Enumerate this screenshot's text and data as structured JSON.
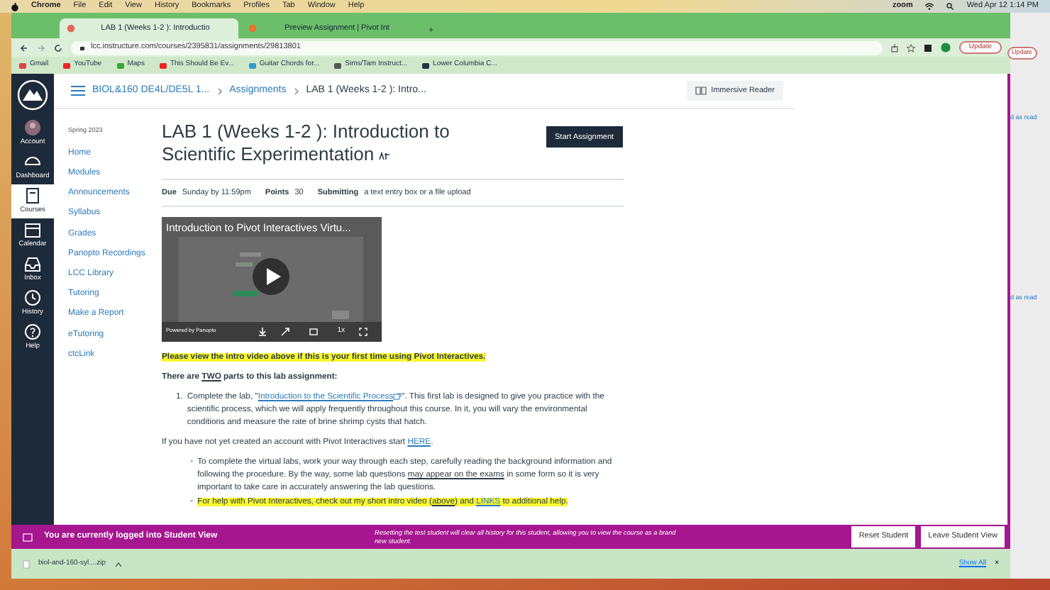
{
  "menu_bar": {
    "app": "Chrome",
    "items": [
      "File",
      "Edit",
      "View",
      "History",
      "Bookmarks",
      "Profiles",
      "Tab",
      "Window",
      "Help"
    ],
    "status": "zoom",
    "clock": "Wed Apr 12  1:14 PM"
  },
  "browser": {
    "tabs": [
      {
        "title": "LAB 1 (Weeks 1-2 ): Introductio",
        "selected": true
      },
      {
        "title": "Preview Assignment | Pivot Int",
        "selected": false
      }
    ],
    "new_tab": "+",
    "url": "lcc.instructure.com/courses/2395831/assignments/29813801",
    "update_button": "Update",
    "bookmarks": [
      "Gmail",
      "YouTube",
      "Maps",
      "This Should Be Ev...",
      "Guitar Chords for...",
      "Sims/Tam Instruct...",
      "Lower Columbia C..."
    ]
  },
  "global_nav": [
    {
      "label": "Account",
      "kind": "account",
      "selected": false
    },
    {
      "label": "Dashboard",
      "kind": "dashboard",
      "selected": false
    },
    {
      "label": "Courses",
      "kind": "courses",
      "selected": true
    },
    {
      "label": "Calendar",
      "kind": "calendar",
      "selected": false
    },
    {
      "label": "Inbox",
      "kind": "inbox",
      "selected": false
    },
    {
      "label": "History",
      "kind": "history",
      "selected": false
    },
    {
      "label": "Help",
      "kind": "help",
      "selected": false
    }
  ],
  "breadcrumb": [
    "BIOL&160 DE4L/DE5L 1...",
    "Assignments",
    "LAB 1 (Weeks 1-2 ): Intro..."
  ],
  "immersive_reader": "Immersive Reader",
  "course_nav": {
    "term": "Spring 2023",
    "items": [
      "Home",
      "Modules",
      "Announcements",
      "Syllabus",
      "Grades",
      "Panopto Recordings",
      "LCC Library",
      "Tutoring",
      "Make a Report",
      "eTutoring",
      "ctcLink"
    ]
  },
  "assignment": {
    "title": "LAB 1 (Weeks 1-2 ): Introduction to Scientific Experimentation",
    "start_button": "Start Assignment",
    "details": [
      {
        "label": "Due",
        "value": "Sunday by 11:59pm"
      },
      {
        "label": "Points",
        "value": "30"
      },
      {
        "label": "Submitting",
        "value": "a text entry box or a file upload"
      }
    ]
  },
  "video": {
    "title": "Introduction to Pivot Interactives Virtu...",
    "credit": "Powered by Panopto",
    "speed": "1x"
  },
  "body": [
    {
      "kind": "paragraph",
      "highlight": true,
      "bold": true,
      "parts": [
        {
          "text": "Please view the intro video above if this is your first time using Pivot Interactives.",
          "kind": "plain"
        }
      ]
    },
    {
      "kind": "paragraph",
      "highlight": false,
      "bold": true,
      "parts": [
        {
          "text": "There are ",
          "kind": "plain"
        },
        {
          "text": "TWO",
          "kind": "underline"
        },
        {
          "text": " parts to this lab assignment:",
          "kind": "plain"
        }
      ]
    },
    {
      "kind": "item",
      "marker": "1.",
      "highlight": false,
      "bold": false,
      "parts": [
        {
          "text": "Complete the lab, \"",
          "kind": "plain"
        },
        {
          "text": "Introduction to the Scientific Process",
          "kind": "link"
        },
        {
          "text": "\".  This first lab is designed to give you practice with the scientific process, which we will apply frequently throughout this course. In it, you will vary the environmental conditions and measure the rate of brine shrimp cysts that hatch.",
          "kind": "plain"
        }
      ]
    },
    {
      "kind": "paragraph",
      "highlight": false,
      "bold": false,
      "parts": [
        {
          "text": "If you have not yet created an account with Pivot Interactives start ",
          "kind": "plain"
        },
        {
          "text": "HERE",
          "kind": "link"
        },
        {
          "text": ".",
          "kind": "plain"
        }
      ]
    },
    {
      "kind": "bullet",
      "marker": "◦",
      "highlight": false,
      "bold": false,
      "parts": [
        {
          "text": "To complete the virtual labs, work your way through each step, carefully reading the background information and following the procedure. By the way, some lab questions ",
          "kind": "plain"
        },
        {
          "text": "may appear on the exams",
          "kind": "underline"
        },
        {
          "text": " in some form so it is very important to take care in accurately answering the lab questions.",
          "kind": "plain"
        }
      ]
    },
    {
      "kind": "bullet",
      "marker": "◦",
      "highlight": true,
      "bold": false,
      "parts": [
        {
          "text": "For help with Pivot Interactives, check out my short intro video (",
          "kind": "plain"
        },
        {
          "text": "above",
          "kind": "underline"
        },
        {
          "text": ") and ",
          "kind": "plain"
        },
        {
          "text": "LINKS",
          "kind": "link"
        },
        {
          "text": " to additional help.",
          "kind": "plain"
        }
      ]
    }
  ],
  "student_view": {
    "message": "You are currently logged into Student View",
    "note": "Resetting the test student will clear all history for this student, allowing you to view the course as a brand new student.",
    "buttons": [
      "Reset Student",
      "Leave Student View"
    ]
  },
  "downloads": {
    "file": "biol-and-160-syl....zip",
    "show_all": "Show All",
    "close": "×"
  },
  "side_window": {
    "button": "Update",
    "notes": [
      "d as read",
      "d as read"
    ]
  }
}
